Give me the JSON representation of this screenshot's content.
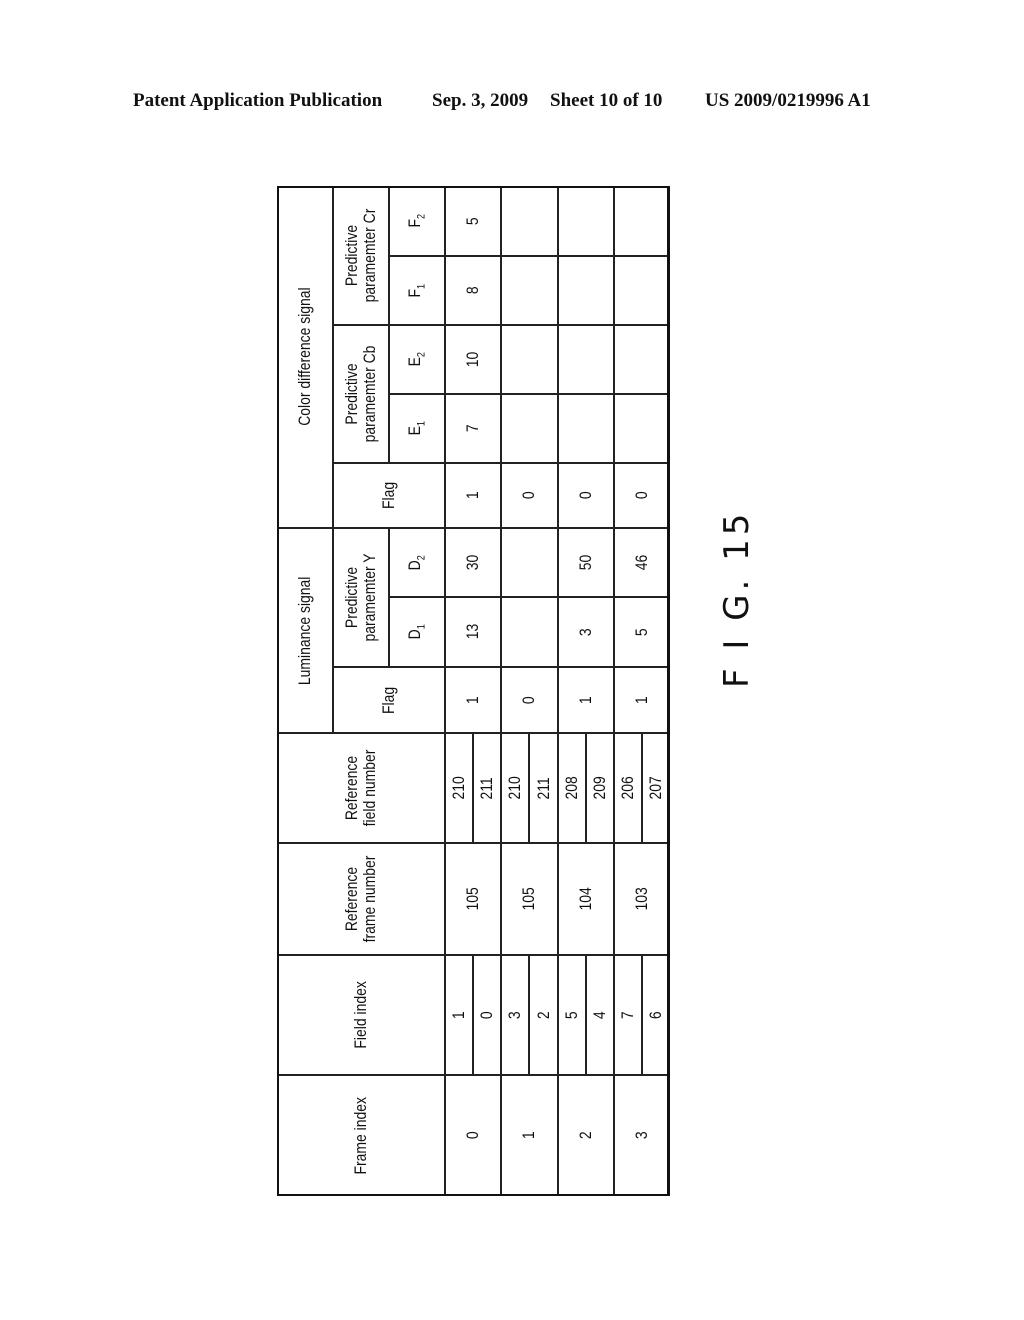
{
  "header": {
    "publication": "Patent Application Publication",
    "date": "Sep. 3, 2009",
    "sheet": "Sheet 10 of 10",
    "number": "US 2009/0219996 A1"
  },
  "table": {
    "headers": {
      "frame_index": "Frame index",
      "field_index": "Field index",
      "ref_frame": "Reference frame number",
      "ref_field": "Reference field number",
      "luminance": "Luminance signal",
      "lum_flag": "Flag",
      "pred_y": "Predictive paramemter Y",
      "d1": "D1",
      "d2": "D2",
      "color_diff": "Color difference signal",
      "cd_flag": "Flag",
      "pred_cb": "Predictive paramemter Cb",
      "e1": "E1",
      "e2": "E2",
      "pred_cr": "Predictive paramemter Cr",
      "f1": "F1",
      "f2": "F2"
    },
    "rows": [
      {
        "frame": "0",
        "fields": [
          "1",
          "0"
        ],
        "ref_frame": "105",
        "ref_fields": [
          "210",
          "211"
        ],
        "lum_flag": "1",
        "d1": "13",
        "d2": "30",
        "cd_flag": "1",
        "e1": "7",
        "e2": "10",
        "f1": "8",
        "f2": "5"
      },
      {
        "frame": "1",
        "fields": [
          "3",
          "2"
        ],
        "ref_frame": "105",
        "ref_fields": [
          "210",
          "211"
        ],
        "lum_flag": "0",
        "d1": "",
        "d2": "",
        "cd_flag": "0",
        "e1": "",
        "e2": "",
        "f1": "",
        "f2": ""
      },
      {
        "frame": "2",
        "fields": [
          "5",
          "4"
        ],
        "ref_frame": "104",
        "ref_fields": [
          "208",
          "209"
        ],
        "lum_flag": "1",
        "d1": "3",
        "d2": "50",
        "cd_flag": "0",
        "e1": "",
        "e2": "",
        "f1": "",
        "f2": ""
      },
      {
        "frame": "3",
        "fields": [
          "7",
          "6"
        ],
        "ref_frame": "103",
        "ref_fields": [
          "206",
          "207"
        ],
        "lum_flag": "1",
        "d1": "5",
        "d2": "46",
        "cd_flag": "0",
        "e1": "",
        "e2": "",
        "f1": "",
        "f2": ""
      }
    ]
  },
  "figure_label": "F I G. 15"
}
